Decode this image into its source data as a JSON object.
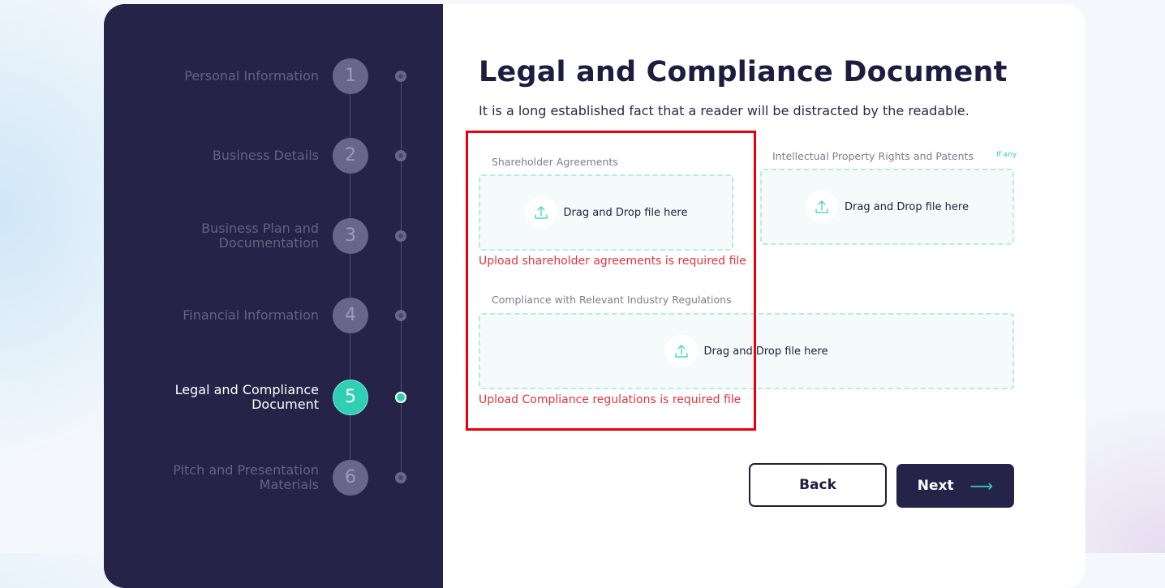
{
  "steps": [
    {
      "number": "1",
      "label": "Personal Information"
    },
    {
      "number": "2",
      "label": "Business Details"
    },
    {
      "number": "3",
      "label": "Business Plan and Documentation"
    },
    {
      "number": "4",
      "label": "Financial Information"
    },
    {
      "number": "5",
      "label": "Legal and Compliance Document"
    },
    {
      "number": "6",
      "label": "Pitch and Presentation Materials"
    }
  ],
  "active_step": 5,
  "main": {
    "title": "Legal and Compliance Document",
    "subtitle": "It is a long established fact that a reader will be distracted by the readable.",
    "fields": {
      "shareholder": {
        "label": "Shareholder Agreements",
        "drop_text": "Drag and Drop file here",
        "error": "Upload shareholder agreements is required file"
      },
      "ip": {
        "label": "Intellectual Property Rights and Patents",
        "badge": "If any",
        "drop_text": "Drag and Drop file here"
      },
      "compliance": {
        "label": "Compliance with Relevant Industry Regulations",
        "drop_text": "Drag and Drop file here",
        "error": "Upload Compliance regulations is required file"
      }
    },
    "buttons": {
      "back": "Back",
      "next": "Next",
      "next_arrow": "⟶"
    }
  },
  "colors": {
    "sidebar_bg": "#252347",
    "accent": "#2ecfb3",
    "error": "#e0353f",
    "highlight_box": "#e5000c"
  },
  "icons": {
    "upload": "upload-icon",
    "next_arrow": "arrow-right-icon"
  }
}
